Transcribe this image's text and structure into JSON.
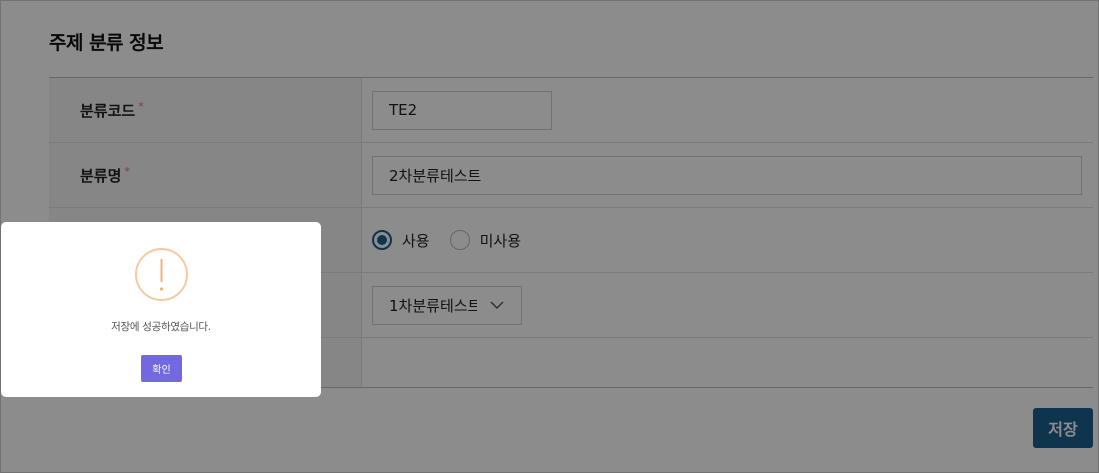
{
  "page": {
    "title": "주제 분류 정보"
  },
  "form": {
    "code": {
      "label": "분류코드",
      "required_mark": "*",
      "value": "TE2"
    },
    "name": {
      "label": "분류명",
      "required_mark": "*",
      "value": "2차분류테스트"
    },
    "usage": {
      "options": [
        {
          "label": "사용",
          "checked": true
        },
        {
          "label": "미사용",
          "checked": false
        }
      ]
    },
    "parent": {
      "selected": "1차분류테스트"
    }
  },
  "actions": {
    "save_label": "저장"
  },
  "dialog": {
    "icon": "exclamation-circle-icon",
    "message": "저장에 성공하였습니다.",
    "confirm_label": "확인"
  },
  "colors": {
    "primary": "#1d5f8c",
    "dialog_button": "#7268e0",
    "alert_icon": "#f3b27a"
  }
}
